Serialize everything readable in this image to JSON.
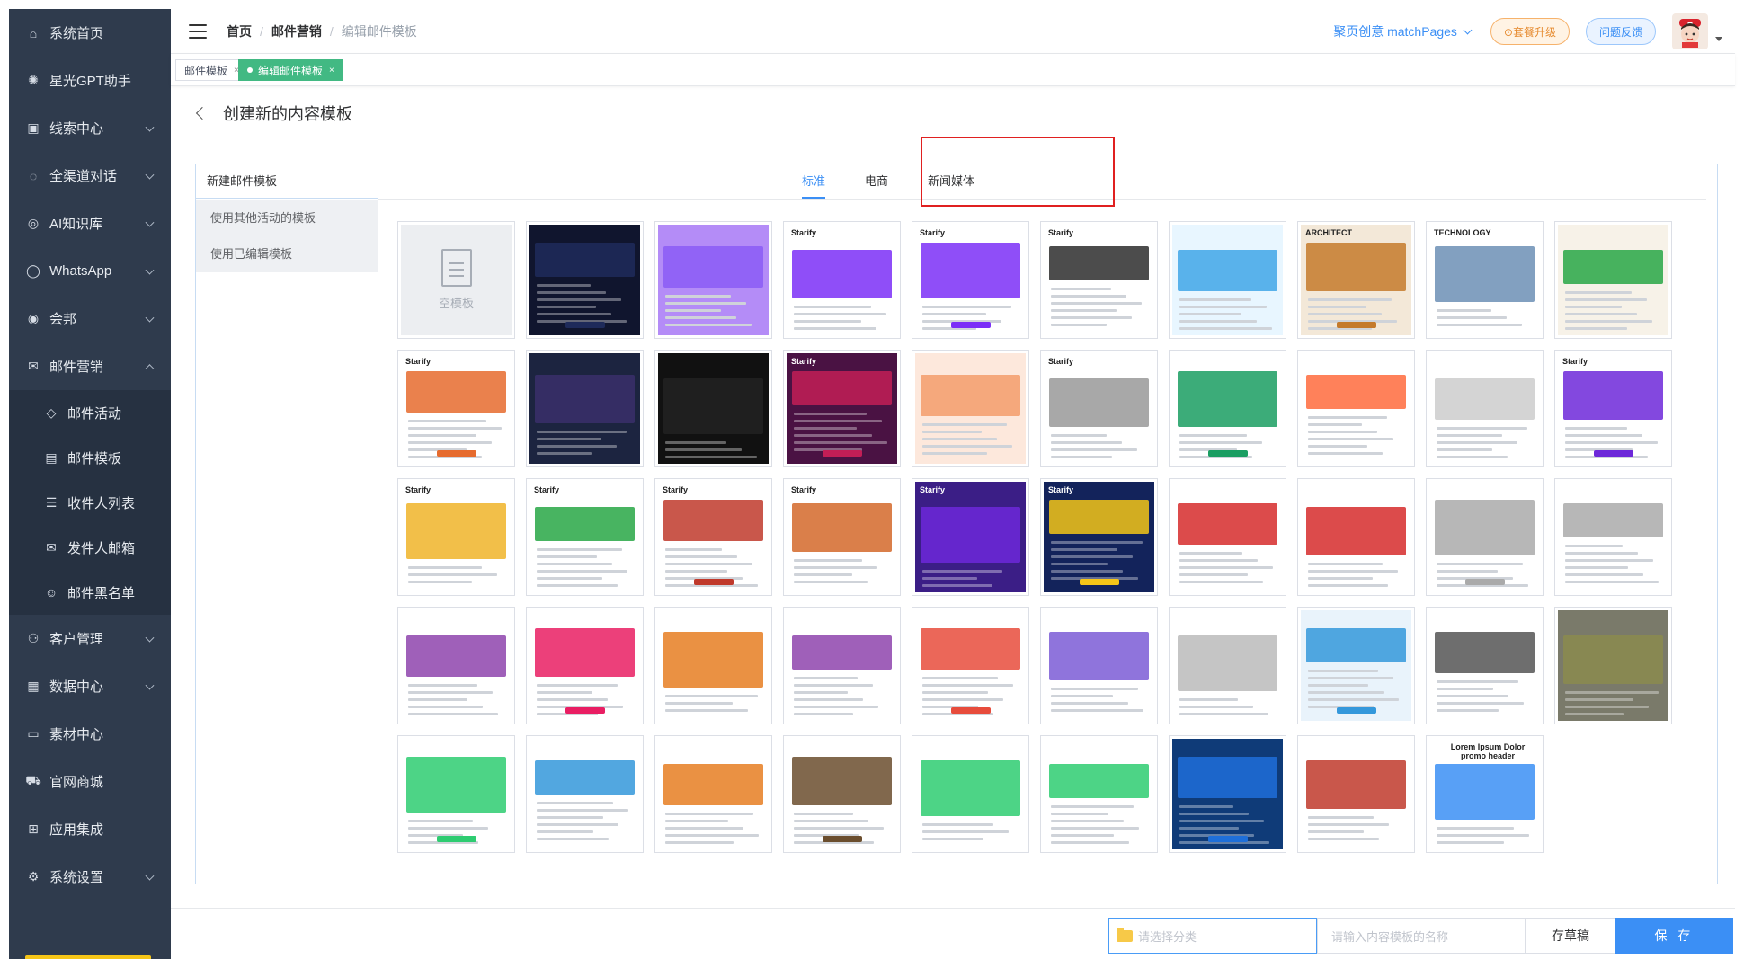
{
  "sidebar": {
    "items": [
      {
        "label": "系统首页",
        "icon": "home-icon",
        "glyph": "⌂",
        "has_chevron": false
      },
      {
        "label": "星光GPT助手",
        "icon": "gpt-icon",
        "glyph": "✺",
        "has_chevron": false
      },
      {
        "label": "线索中心",
        "icon": "clue-icon",
        "glyph": "▣",
        "has_chevron": true
      },
      {
        "label": "全渠道对话",
        "icon": "chat-icon",
        "glyph": "◌",
        "has_chevron": true
      },
      {
        "label": "AI知识库",
        "icon": "knowledge-icon",
        "glyph": "◎",
        "has_chevron": true
      },
      {
        "label": "WhatsApp",
        "icon": "whatsapp-icon",
        "glyph": "◯",
        "has_chevron": true
      },
      {
        "label": "会邦",
        "icon": "location-icon",
        "glyph": "◉",
        "has_chevron": true
      },
      {
        "label": "邮件营销",
        "icon": "mail-icon",
        "glyph": "✉",
        "has_chevron": true,
        "expanded": true
      }
    ],
    "subitems": [
      {
        "label": "邮件活动",
        "icon": "tag-icon",
        "glyph": "◇"
      },
      {
        "label": "邮件模板",
        "icon": "template-icon",
        "glyph": "▤"
      },
      {
        "label": "收件人列表",
        "icon": "list-icon",
        "glyph": "☰"
      },
      {
        "label": "发件人邮箱",
        "icon": "mailbox-icon",
        "glyph": "✉"
      },
      {
        "label": "邮件黑名单",
        "icon": "user-block-icon",
        "glyph": "☺"
      }
    ],
    "items_after": [
      {
        "label": "客户管理",
        "icon": "customers-icon",
        "glyph": "⚇",
        "has_chevron": true
      },
      {
        "label": "数据中心",
        "icon": "database-icon",
        "glyph": "▦",
        "has_chevron": true
      },
      {
        "label": "素材中心",
        "icon": "folder-icon",
        "glyph": "▭",
        "has_chevron": false
      },
      {
        "label": "官网商城",
        "icon": "cart-icon",
        "glyph": "⛟",
        "has_chevron": false
      },
      {
        "label": "应用集成",
        "icon": "apps-icon",
        "glyph": "⊞",
        "has_chevron": false
      },
      {
        "label": "系统设置",
        "icon": "settings-icon",
        "glyph": "⚙",
        "has_chevron": true
      }
    ]
  },
  "header": {
    "breadcrumb": [
      "首页",
      "邮件营销",
      "编辑邮件模板"
    ],
    "brand": "聚页创意 matchPages",
    "upgrade": "⊙套餐升级",
    "feedback": "问题反馈"
  },
  "view_tabs": [
    {
      "label": "邮件模板",
      "active": false
    },
    {
      "label": "编辑邮件模板",
      "active": true
    }
  ],
  "page": {
    "title": "创建新的内容模板"
  },
  "left_nav": {
    "heading": "新建邮件模板",
    "items": [
      "使用其他活动的模板",
      "使用已编辑模板"
    ]
  },
  "category_tabs": [
    {
      "label": "标准",
      "active": true
    },
    {
      "label": "电商",
      "active": false
    },
    {
      "label": "新闻媒体",
      "active": false
    }
  ],
  "empty_template_label": "空模板",
  "templates": [
    {
      "title": "",
      "accent": "#1e2a5a",
      "bg": "#10152e"
    },
    {
      "title": "",
      "accent": "#8b5cf6",
      "bg": "#b48cf7"
    },
    {
      "title": "Starify",
      "accent": "#7b2ff7",
      "bg": "#ffffff"
    },
    {
      "title": "Starify",
      "accent": "#7b2ff7",
      "bg": "#ffffff"
    },
    {
      "title": "Starify",
      "accent": "#2d2d2d",
      "bg": "#ffffff"
    },
    {
      "title": "",
      "accent": "#3fa6e8",
      "bg": "#e8f6ff"
    },
    {
      "title": "ARCHITECT",
      "accent": "#c47a2c",
      "bg": "#f3e8d8"
    },
    {
      "title": "TECHNOLOGY",
      "accent": "#6c8fb5",
      "bg": "#ffffff"
    },
    {
      "title": "",
      "accent": "#28a745",
      "bg": "#f7f2e8"
    },
    {
      "title": "Starify",
      "accent": "#e66b2e",
      "bg": "#ffffff"
    },
    {
      "title": "",
      "accent": "#3a2f6b",
      "bg": "#1c2440"
    },
    {
      "title": "",
      "accent": "#222222",
      "bg": "#111111"
    },
    {
      "title": "Starify",
      "accent": "#c21e56",
      "bg": "#4a1243"
    },
    {
      "title": "",
      "accent": "#f39c6b",
      "bg": "#fde8dc"
    },
    {
      "title": "Starify",
      "accent": "#999999",
      "bg": "#ffffff"
    },
    {
      "title": "",
      "accent": "#1a9e62",
      "bg": "#ffffff"
    },
    {
      "title": "",
      "accent": "#ff6b3d",
      "bg": "#ffffff"
    },
    {
      "title": "",
      "accent": "#cccccc",
      "bg": "#ffffff"
    },
    {
      "title": "Starify",
      "accent": "#6d28d9",
      "bg": "#ffffff"
    },
    {
      "title": "Starify",
      "accent": "#f0b429",
      "bg": "#ffffff"
    },
    {
      "title": "Starify",
      "accent": "#28a745",
      "bg": "#ffffff"
    },
    {
      "title": "Starify",
      "accent": "#c0392b",
      "bg": "#ffffff"
    },
    {
      "title": "Starify",
      "accent": "#d4682a",
      "bg": "#ffffff"
    },
    {
      "title": "Starify",
      "accent": "#6d28d9",
      "bg": "#3b1e86"
    },
    {
      "title": "Starify",
      "accent": "#f5c518",
      "bg": "#13235b"
    },
    {
      "title": "",
      "accent": "#d62c2c",
      "bg": "#ffffff"
    },
    {
      "title": "",
      "accent": "#d62c2c",
      "bg": "#ffffff"
    },
    {
      "title": "",
      "accent": "#aaaaaa",
      "bg": "#ffffff"
    },
    {
      "title": "",
      "accent": "#aaaaaa",
      "bg": "#ffffff"
    },
    {
      "title": "",
      "accent": "#8e44ad",
      "bg": "#ffffff"
    },
    {
      "title": "",
      "accent": "#e91e63",
      "bg": "#ffffff"
    },
    {
      "title": "",
      "accent": "#e67e22",
      "bg": "#ffffff"
    },
    {
      "title": "",
      "accent": "#8e44ad",
      "bg": "#ffffff"
    },
    {
      "title": "",
      "accent": "#e74c3c",
      "bg": "#ffffff"
    },
    {
      "title": "",
      "accent": "#7b5cd6",
      "bg": "#ffffff"
    },
    {
      "title": "",
      "accent": "#bbbbbb",
      "bg": "#ffffff"
    },
    {
      "title": "",
      "accent": "#3498db",
      "bg": "#e9f3fb"
    },
    {
      "title": "",
      "accent": "#555555",
      "bg": "#ffffff"
    },
    {
      "title": "",
      "accent": "#8b8b4e",
      "bg": "#7a7a6a"
    },
    {
      "title": "",
      "accent": "#2ecc71",
      "bg": "#ffffff"
    },
    {
      "title": "",
      "accent": "#3498db",
      "bg": "#ffffff"
    },
    {
      "title": "",
      "accent": "#e67e22",
      "bg": "#ffffff"
    },
    {
      "title": "",
      "accent": "#6b4e2e",
      "bg": "#ffffff"
    },
    {
      "title": "",
      "accent": "#2ecc71",
      "bg": "#ffffff"
    },
    {
      "title": "",
      "accent": "#2ecc71",
      "bg": "#ffffff"
    },
    {
      "title": "",
      "accent": "#1e6fd9",
      "bg": "#0f3b78"
    },
    {
      "title": "",
      "accent": "#c0392b",
      "bg": "#ffffff"
    },
    {
      "title": "Lorem Ipsum Dolor promo header",
      "accent": "#3b8ff5",
      "bg": "#ffffff"
    }
  ],
  "footer": {
    "category_placeholder": "请选择分类",
    "name_placeholder": "请输入内容模板的名称",
    "draft": "存草稿",
    "save": "保 存"
  }
}
